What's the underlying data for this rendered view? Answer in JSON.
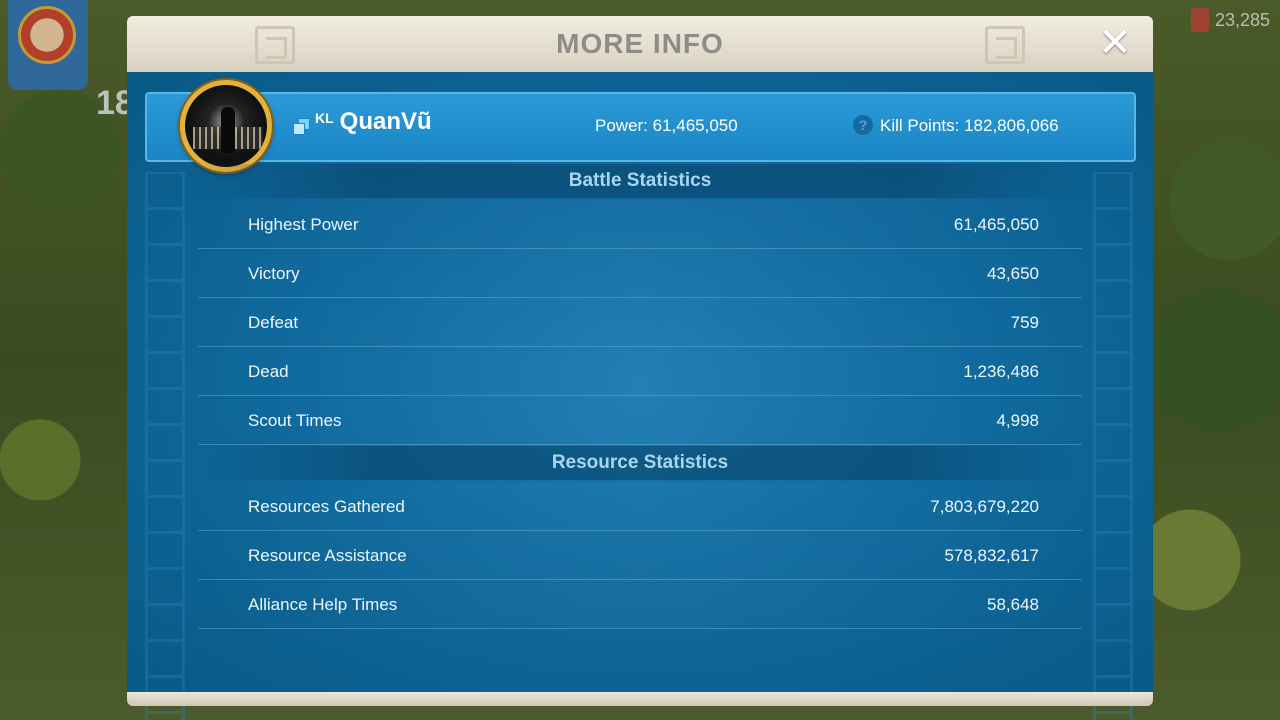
{
  "background": {
    "level_badge": "18",
    "gems_value": "23,285"
  },
  "dialog": {
    "title": "MORE INFO",
    "close_glyph": "✕"
  },
  "player": {
    "alliance_tag": "KL",
    "name": "QuanVũ",
    "power_text": "Power: 61,465,050",
    "kill_points_text": "Kill Points: 182,806,066",
    "help_glyph": "?"
  },
  "battle": {
    "title": "Battle Statistics",
    "rows": [
      {
        "label": "Highest Power",
        "value": "61,465,050"
      },
      {
        "label": "Victory",
        "value": "43,650"
      },
      {
        "label": "Defeat",
        "value": "759"
      },
      {
        "label": "Dead",
        "value": "1,236,486"
      },
      {
        "label": "Scout Times",
        "value": "4,998"
      }
    ]
  },
  "resource": {
    "title": "Resource Statistics",
    "rows": [
      {
        "label": "Resources Gathered",
        "value": "7,803,679,220"
      },
      {
        "label": "Resource Assistance",
        "value": "578,832,617"
      },
      {
        "label": "Alliance Help Times",
        "value": "58,648"
      }
    ]
  },
  "colors": {
    "panel_blue": "#1a7bb2",
    "banner_blue": "#2a9ad6",
    "header_beige": "#f2ede2",
    "avatar_ring_gold": "#e2b23a",
    "section_title_text": "#a8d6f0"
  },
  "icons": [
    "close-icon",
    "copy-icon",
    "help-icon",
    "gem-icon"
  ]
}
